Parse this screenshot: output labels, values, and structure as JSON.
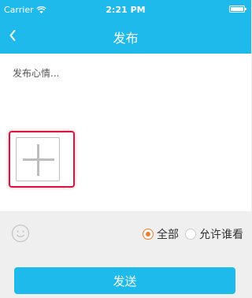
{
  "status_bar": {
    "carrier": "Carrier",
    "time": "2:21 PM"
  },
  "nav": {
    "title": "发布",
    "back_icon": "chevron-left-icon"
  },
  "editor": {
    "placeholder": "发布心情..."
  },
  "add_photo": {
    "icon": "plus-icon"
  },
  "visibility": {
    "emoji_icon": "smiley-icon",
    "options": [
      {
        "label": "全部",
        "selected": true
      },
      {
        "label": "允许谁看",
        "selected": false
      }
    ]
  },
  "submit": {
    "label": "发送"
  },
  "colors": {
    "primary": "#1ebaec",
    "accent": "#f07a2f",
    "highlight": "#d7153f"
  }
}
